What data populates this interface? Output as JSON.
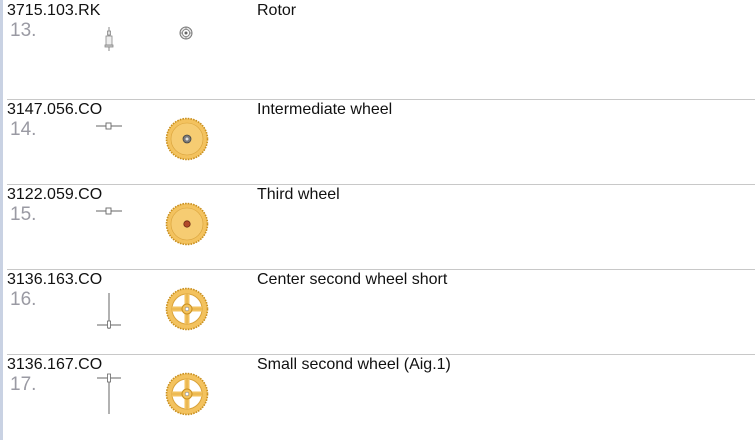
{
  "parts": [
    {
      "part_number": "3715.103.RK",
      "index": "13.",
      "name": "Rotor"
    },
    {
      "part_number": "3147.056.CO",
      "index": "14.",
      "name": "Intermediate wheel"
    },
    {
      "part_number": "3122.059.CO",
      "index": "15.",
      "name": "Third wheel"
    },
    {
      "part_number": "3136.163.CO",
      "index": "16.",
      "name": "Center second wheel short"
    },
    {
      "part_number": "3136.167.CO",
      "index": "17.",
      "name": "Small second wheel (Aig.1)"
    }
  ],
  "colors": {
    "gear_gold": "#f3c25e",
    "gear_outline": "#c98f1d",
    "index_gray": "#9a9aa3",
    "divider": "#c8c8c8",
    "left_rule": "#c9d2e3"
  },
  "icons": {
    "rotor_side": "rotor-pin-side-view-icon",
    "rotor_top": "rotor-bearing-icon",
    "wheel_side": "wheel-pinion-side-view-icon",
    "wheel_top": "gold-wheel-icon",
    "spoked_wheel_top": "spoked-gold-wheel-icon"
  }
}
